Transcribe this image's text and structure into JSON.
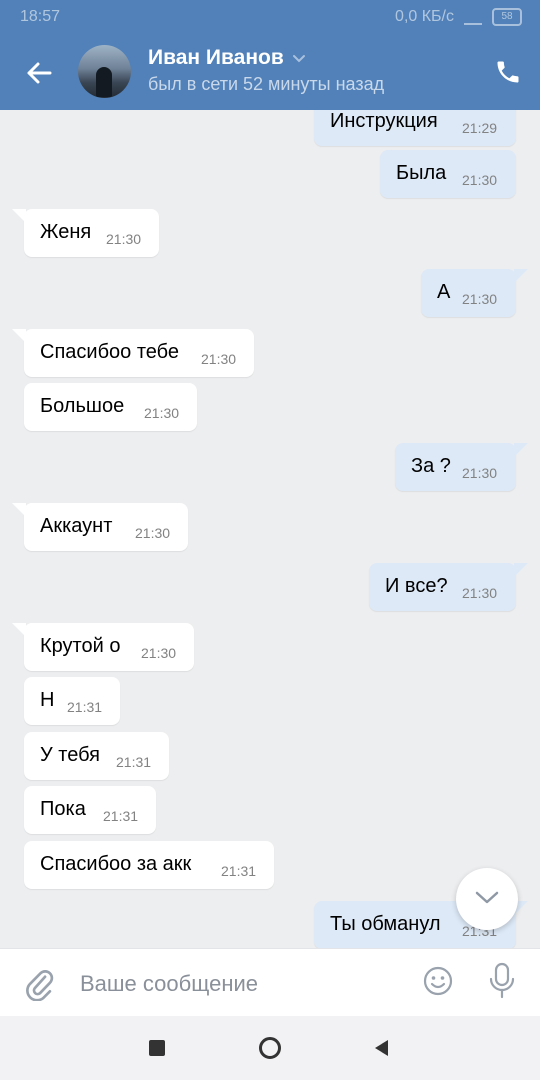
{
  "status_bar": {
    "time": "18:57",
    "speed": "0,0 КБ/с",
    "battery": "58"
  },
  "header": {
    "contact_name": "Иван Иванов",
    "last_seen": "был в сети 52 минуты назад",
    "accent_color": "#5181b8"
  },
  "messages": [
    {
      "dir": "out",
      "text": "Инструкция",
      "time": "21:29"
    },
    {
      "dir": "out",
      "text": "Была",
      "time": "21:30"
    },
    {
      "dir": "in",
      "text": "Женя",
      "time": "21:30"
    },
    {
      "dir": "out",
      "text": "А",
      "time": "21:30"
    },
    {
      "dir": "in",
      "text": "Спасибоо тебе",
      "time": "21:30"
    },
    {
      "dir": "in",
      "text": "Большое",
      "time": "21:30"
    },
    {
      "dir": "out",
      "text": "За ?",
      "time": "21:30"
    },
    {
      "dir": "in",
      "text": "Аккаунт",
      "time": "21:30"
    },
    {
      "dir": "out",
      "text": "И все?",
      "time": "21:30"
    },
    {
      "dir": "in",
      "text": "Крутой о",
      "time": "21:30"
    },
    {
      "dir": "in",
      "text": "Н",
      "time": "21:31"
    },
    {
      "dir": "in",
      "text": "У тебя",
      "time": "21:31"
    },
    {
      "dir": "in",
      "text": "Пока",
      "time": "21:31"
    },
    {
      "dir": "in",
      "text": "Спасибоо за акк",
      "time": "21:31"
    },
    {
      "dir": "out",
      "text": "Ты обманул",
      "time": "21:31"
    }
  ],
  "composer": {
    "placeholder": "Ваше сообщение",
    "value": ""
  },
  "icons": {
    "back": "arrow-left-icon",
    "phone": "phone-icon",
    "attach": "paperclip-icon",
    "emoji": "smile-icon",
    "voice": "microphone-icon",
    "scroll": "chevron-down-icon"
  },
  "colors": {
    "incoming_bubble": "#ffffff",
    "outgoing_bubble": "#dde9f7",
    "chat_background": "#edeef0"
  }
}
